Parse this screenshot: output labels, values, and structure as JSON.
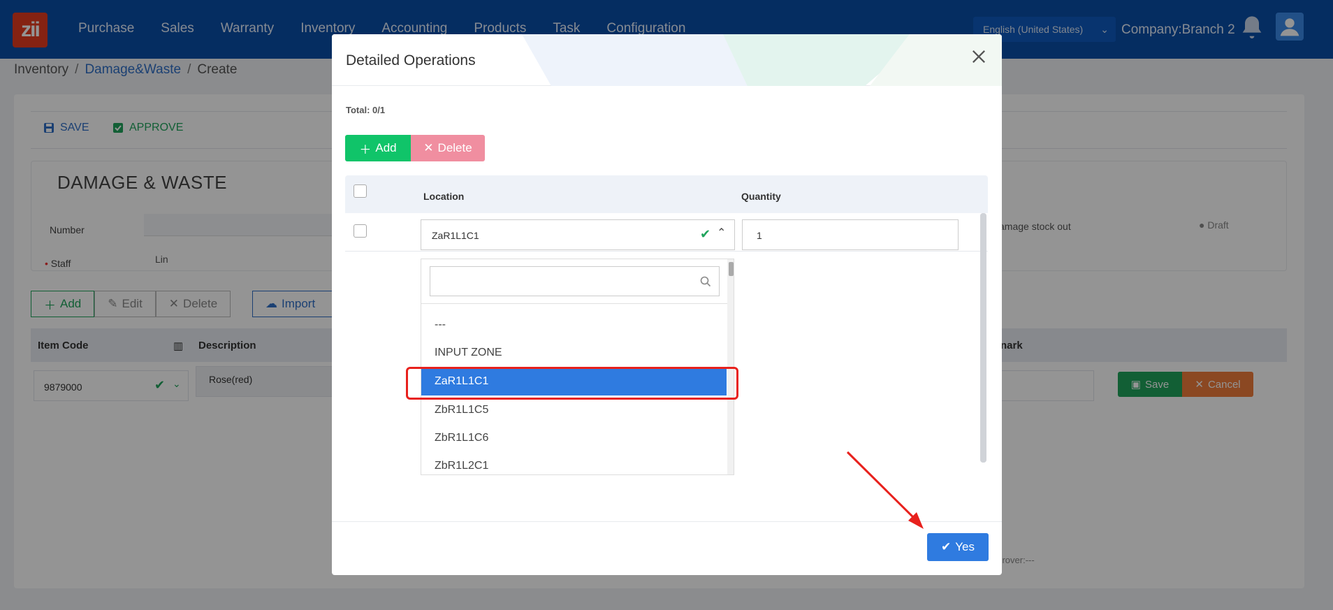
{
  "app": {
    "logo_text": "zii",
    "nav": [
      "Purchase",
      "Sales",
      "Warranty",
      "Inventory",
      "Accounting",
      "Products",
      "Task",
      "Configuration"
    ],
    "language": "English (United States)",
    "company": "Company:Branch 2"
  },
  "breadcrumb": {
    "root": "Inventory",
    "parent": "Damage&Waste",
    "current": "Create"
  },
  "toolbar": {
    "save_label": "SAVE",
    "approve_label": "APPROVE"
  },
  "form": {
    "title": "DAMAGE & WASTE",
    "number_label": "Number",
    "staff_label": "Staff",
    "staff_value": "Lin",
    "type_value": "amage stock out",
    "status": "Draft",
    "approver": "pprover:---"
  },
  "item_buttons": {
    "add": "Add",
    "edit": "Edit",
    "delete": "Delete",
    "import": "Import"
  },
  "item_table": {
    "headers": {
      "item_code": "Item Code",
      "description": "Description",
      "remark": "nark"
    },
    "row": {
      "item_code": "9879000",
      "description": "Rose(red)",
      "save": "Save",
      "cancel": "Cancel"
    }
  },
  "modal": {
    "title": "Detailed Operations",
    "total": "Total: 0/1",
    "add_label": "Add",
    "delete_label": "Delete",
    "col_location": "Location",
    "col_quantity": "Quantity",
    "row": {
      "location": "ZaR1L1C1",
      "quantity": "1"
    },
    "dropdown_options": [
      "---",
      "INPUT ZONE",
      "ZaR1L1C1",
      "ZbR1L1C5",
      "ZbR1L1C6",
      "ZbR1L2C1"
    ],
    "yes_label": "Yes"
  },
  "colors": {
    "topbar": "#0a4ea8",
    "primary": "#2f7be0",
    "success": "#10c469",
    "danger": "#f08ea0",
    "highlight": "#e8211d"
  }
}
